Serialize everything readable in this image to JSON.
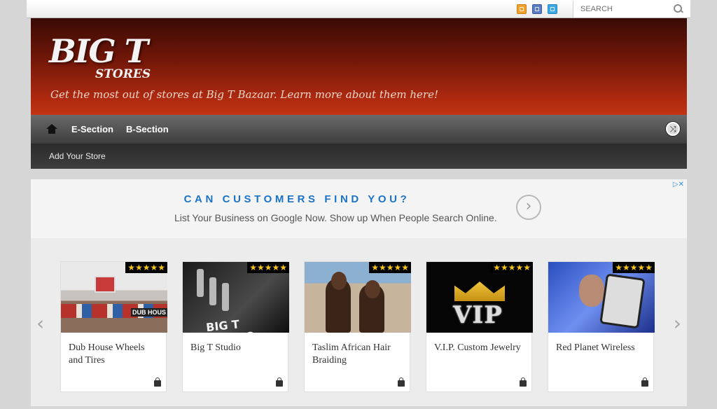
{
  "topbar": {
    "search_placeholder": "SEARCH",
    "icons": [
      "rss-icon",
      "facebook-icon",
      "twitter-icon"
    ]
  },
  "header": {
    "logo_big": "BIG T",
    "logo_small": "STORES",
    "tagline": "Get the most out of stores at Big T Bazaar. Learn more about them here!"
  },
  "nav": {
    "items": [
      "E-Section",
      "B-Section"
    ],
    "sub_items": [
      "Add Your Store"
    ]
  },
  "ad": {
    "headline": "CAN CUSTOMERS FIND YOU?",
    "subline": "List Your Business on Google Now. Show up When People Search Online."
  },
  "carousel": {
    "stars": "★★★★★",
    "cards": [
      {
        "name": "Dub House Wheels and Tires",
        "rating": 5
      },
      {
        "name": "Big T Studio",
        "rating": 5
      },
      {
        "name": "Taslim African Hair Braiding",
        "rating": 5
      },
      {
        "name": "V.I.P. Custom Jewelry",
        "rating": 5
      },
      {
        "name": "Red Planet Wireless",
        "rating": 5
      }
    ]
  },
  "colors": {
    "header_top": "#3a0a04",
    "header_bottom": "#c23414",
    "ad_headline": "#1a73c7",
    "star": "#f5c518"
  }
}
